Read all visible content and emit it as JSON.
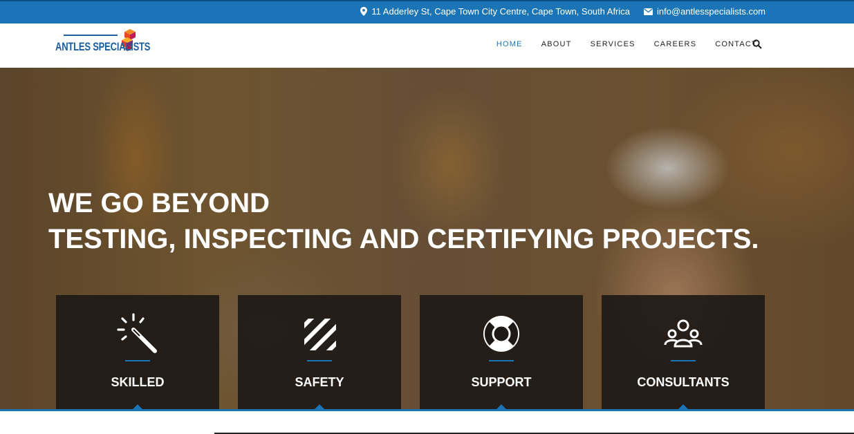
{
  "topbar": {
    "address": "11 Adderley St, Cape Town City Centre, Cape Town, South Africa",
    "email": "info@antlesspecialists.com",
    "pin_icon": "map-marker-icon",
    "mail_icon": "envelope-icon"
  },
  "header": {
    "logo_text": "ANTLES SPECIALISTS",
    "nav": [
      {
        "label": "HOME",
        "active": true
      },
      {
        "label": "ABOUT"
      },
      {
        "label": "SERVICES"
      },
      {
        "label": "CAREERS"
      },
      {
        "label": "CONTACT"
      }
    ],
    "search_icon": "search-icon"
  },
  "hero": {
    "line1": "WE GO BEYOND",
    "line2": "TESTING, INSPECTING AND CERTIFYING PROJECTS."
  },
  "features": [
    {
      "label": "SKILLED",
      "icon": "magic-wand-icon"
    },
    {
      "label": "SAFETY",
      "icon": "striped-square-icon"
    },
    {
      "label": "SUPPORT",
      "icon": "life-ring-icon"
    },
    {
      "label": "CONSULTANTS",
      "icon": "users-icon"
    }
  ],
  "colors": {
    "accent": "#1a74b6",
    "card_bg": "#1e1916"
  }
}
